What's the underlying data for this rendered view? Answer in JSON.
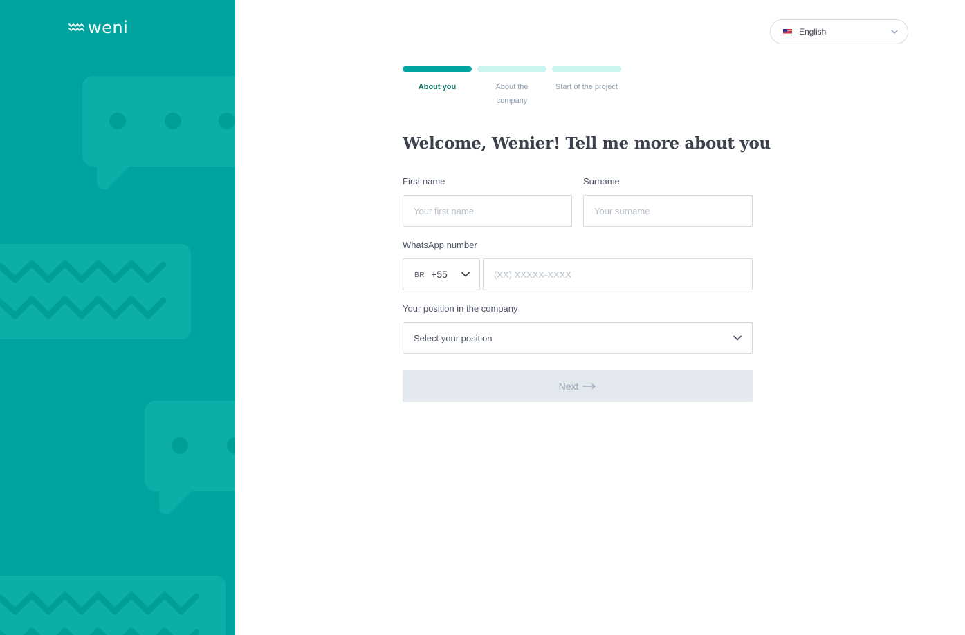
{
  "brand": {
    "name": "weni"
  },
  "language": {
    "selected": "English",
    "flag_icon": "us-flag-icon"
  },
  "steps": [
    {
      "label": "About you",
      "active": true
    },
    {
      "label": "About the company",
      "active": false
    },
    {
      "label": "Start of the project",
      "active": false
    }
  ],
  "form": {
    "heading": "Welcome, Wenier! Tell me more about you",
    "first_name": {
      "label": "First name",
      "placeholder": "Your first name",
      "value": ""
    },
    "surname": {
      "label": "Surname",
      "placeholder": "Your surname",
      "value": ""
    },
    "whatsapp": {
      "label": "WhatsApp number",
      "country_code": "BR",
      "dial_code": "+55",
      "placeholder": "(XX) XXXXX-XXXX",
      "value": ""
    },
    "position": {
      "label": "Your position in the company",
      "placeholder": "Select your position"
    },
    "next_label": "Next"
  },
  "colors": {
    "brand_teal": "#00A49F",
    "step_active": "#00A49F",
    "step_inactive": "#C9F5F1",
    "button_disabled_bg": "#E3E7EE"
  }
}
